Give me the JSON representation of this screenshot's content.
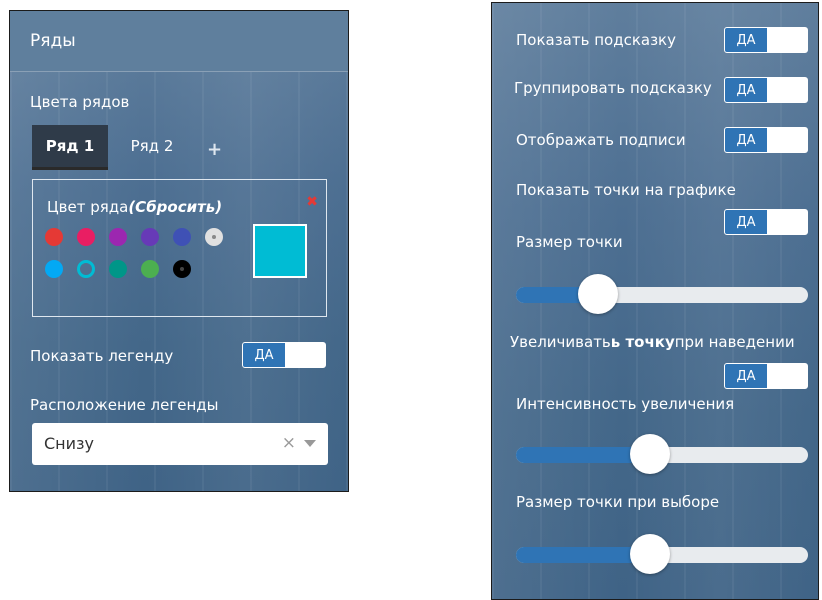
{
  "left_panel": {
    "title": "Ряды",
    "series_colors_label": "Цвета рядов",
    "tabs": [
      {
        "label": "Ряд 1",
        "active": true
      },
      {
        "label": "Ряд 2",
        "active": false
      }
    ],
    "add_tab_symbol": "+",
    "color_picker": {
      "label": "Цвет ряда",
      "reset_label": "(Сбросить)",
      "delete_icon": "close-icon",
      "palette_row1": [
        "#e53935",
        "#e91e63",
        "#9c27b0",
        "#673ab7",
        "#3f51b5",
        "#e0e0e0"
      ],
      "palette_row2": [
        "#03a9f4",
        "#00bcd4",
        "#009688",
        "#4caf50",
        "#000000"
      ],
      "selected_color": "#00bcd4"
    },
    "show_legend": {
      "label": "Показать легенду",
      "value": "ДА"
    },
    "legend_position": {
      "label": "Расположение легенды",
      "value": "Снизу"
    }
  },
  "right_panel": {
    "show_tooltip": {
      "label": "Показать подсказку",
      "value": "ДА"
    },
    "group_tooltip": {
      "label": "Группировать подсказку",
      "value": "ДА"
    },
    "show_labels": {
      "label": "Отображать подписи",
      "value": "ДА"
    },
    "show_points": {
      "label": "Показать точки на графике",
      "value": "ДА"
    },
    "point_size": {
      "label": "Размер точки",
      "level": 0.28
    },
    "enlarge_hover": {
      "label_pre": "Увеличивать",
      "label_bold": "ь точку",
      "label_post": "при наведении",
      "value": "ДА"
    },
    "enlarge_intensity": {
      "label": "Интенсивность увеличения",
      "level": 0.46
    },
    "selected_point_size": {
      "label": "Размер точки при выборе",
      "level": 0.46
    }
  },
  "colors": {
    "accent": "#2f74b5",
    "active_tab": "#2f3b49",
    "delete": "#e53935"
  }
}
